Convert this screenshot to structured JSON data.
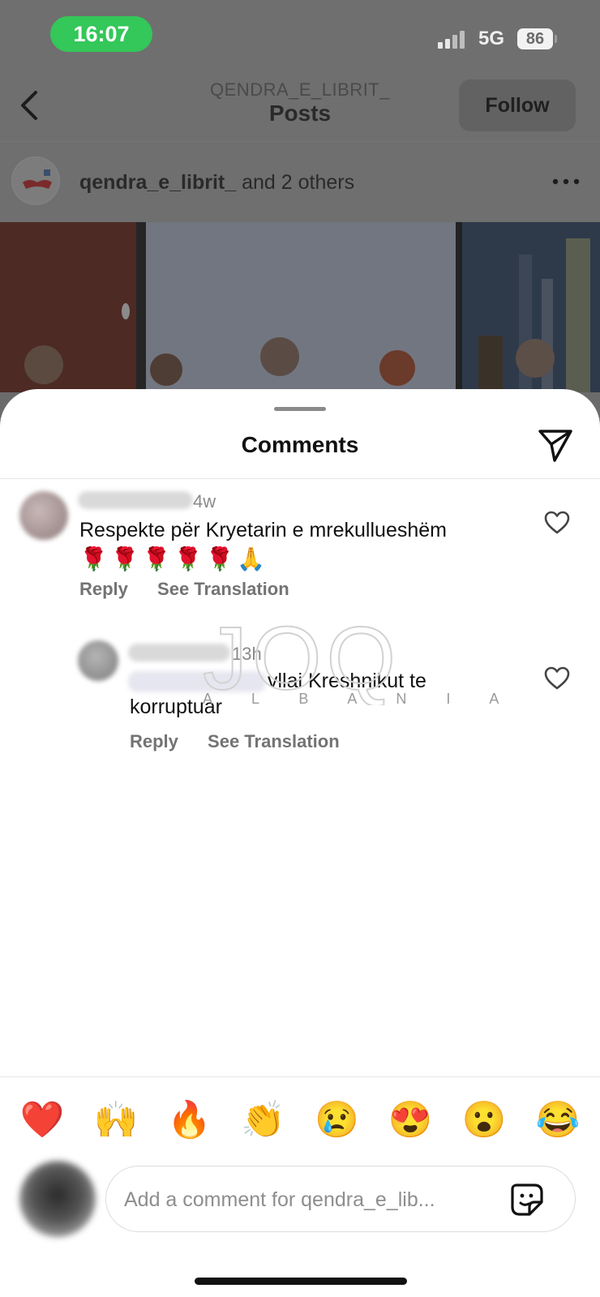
{
  "status_bar": {
    "time": "16:07",
    "network": "5G",
    "battery": "86",
    "time_pill_color": "#34c759"
  },
  "navbar": {
    "username": "QENDRA_E_LIBRIT_",
    "title": "Posts",
    "follow_label": "Follow",
    "back_icon": "chevron-left-icon"
  },
  "post": {
    "owner": "qendra_e_librit_",
    "others": "and 2 others",
    "more_icon": "more-horizontal-icon"
  },
  "comments_sheet": {
    "title": "Comments",
    "send_icon": "paper-plane-icon",
    "comments": [
      {
        "time": "4w",
        "text": "Respekte për Kryetarin e mrekullueshëm",
        "emojis": "🌹🌹🌹🌹🌹🙏",
        "reply_label": "Reply",
        "translate_label": "See Translation",
        "like_icon": "heart-icon"
      },
      {
        "time": "13h",
        "text_fragment": "vllai Kreshnikut te",
        "text_line2": "korruptuar",
        "reply_label": "Reply",
        "translate_label": "See Translation",
        "like_icon": "heart-icon"
      }
    ]
  },
  "watermark": {
    "logo": "JOQ",
    "letters": "A L B A N I A"
  },
  "reactions": [
    "❤️",
    "🙌",
    "🔥",
    "👏",
    "😢",
    "😍",
    "😮",
    "😂"
  ],
  "composer": {
    "placeholder": "Add a comment for qendra_e_lib...",
    "sticker_icon": "sticker-icon"
  },
  "colors": {
    "accent_green": "#34c759",
    "heart_red": "#e0245e"
  }
}
